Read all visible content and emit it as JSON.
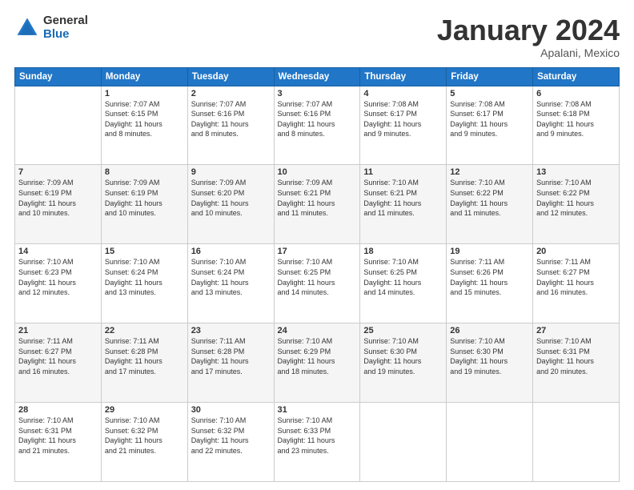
{
  "logo": {
    "general": "General",
    "blue": "Blue"
  },
  "title": "January 2024",
  "location": "Apalani, Mexico",
  "weekdays": [
    "Sunday",
    "Monday",
    "Tuesday",
    "Wednesday",
    "Thursday",
    "Friday",
    "Saturday"
  ],
  "weeks": [
    [
      {
        "day": "",
        "info": ""
      },
      {
        "day": "1",
        "info": "Sunrise: 7:07 AM\nSunset: 6:15 PM\nDaylight: 11 hours\nand 8 minutes."
      },
      {
        "day": "2",
        "info": "Sunrise: 7:07 AM\nSunset: 6:16 PM\nDaylight: 11 hours\nand 8 minutes."
      },
      {
        "day": "3",
        "info": "Sunrise: 7:07 AM\nSunset: 6:16 PM\nDaylight: 11 hours\nand 8 minutes."
      },
      {
        "day": "4",
        "info": "Sunrise: 7:08 AM\nSunset: 6:17 PM\nDaylight: 11 hours\nand 9 minutes."
      },
      {
        "day": "5",
        "info": "Sunrise: 7:08 AM\nSunset: 6:17 PM\nDaylight: 11 hours\nand 9 minutes."
      },
      {
        "day": "6",
        "info": "Sunrise: 7:08 AM\nSunset: 6:18 PM\nDaylight: 11 hours\nand 9 minutes."
      }
    ],
    [
      {
        "day": "7",
        "info": "Sunrise: 7:09 AM\nSunset: 6:19 PM\nDaylight: 11 hours\nand 10 minutes."
      },
      {
        "day": "8",
        "info": "Sunrise: 7:09 AM\nSunset: 6:19 PM\nDaylight: 11 hours\nand 10 minutes."
      },
      {
        "day": "9",
        "info": "Sunrise: 7:09 AM\nSunset: 6:20 PM\nDaylight: 11 hours\nand 10 minutes."
      },
      {
        "day": "10",
        "info": "Sunrise: 7:09 AM\nSunset: 6:21 PM\nDaylight: 11 hours\nand 11 minutes."
      },
      {
        "day": "11",
        "info": "Sunrise: 7:10 AM\nSunset: 6:21 PM\nDaylight: 11 hours\nand 11 minutes."
      },
      {
        "day": "12",
        "info": "Sunrise: 7:10 AM\nSunset: 6:22 PM\nDaylight: 11 hours\nand 11 minutes."
      },
      {
        "day": "13",
        "info": "Sunrise: 7:10 AM\nSunset: 6:22 PM\nDaylight: 11 hours\nand 12 minutes."
      }
    ],
    [
      {
        "day": "14",
        "info": "Sunrise: 7:10 AM\nSunset: 6:23 PM\nDaylight: 11 hours\nand 12 minutes."
      },
      {
        "day": "15",
        "info": "Sunrise: 7:10 AM\nSunset: 6:24 PM\nDaylight: 11 hours\nand 13 minutes."
      },
      {
        "day": "16",
        "info": "Sunrise: 7:10 AM\nSunset: 6:24 PM\nDaylight: 11 hours\nand 13 minutes."
      },
      {
        "day": "17",
        "info": "Sunrise: 7:10 AM\nSunset: 6:25 PM\nDaylight: 11 hours\nand 14 minutes."
      },
      {
        "day": "18",
        "info": "Sunrise: 7:10 AM\nSunset: 6:25 PM\nDaylight: 11 hours\nand 14 minutes."
      },
      {
        "day": "19",
        "info": "Sunrise: 7:11 AM\nSunset: 6:26 PM\nDaylight: 11 hours\nand 15 minutes."
      },
      {
        "day": "20",
        "info": "Sunrise: 7:11 AM\nSunset: 6:27 PM\nDaylight: 11 hours\nand 16 minutes."
      }
    ],
    [
      {
        "day": "21",
        "info": "Sunrise: 7:11 AM\nSunset: 6:27 PM\nDaylight: 11 hours\nand 16 minutes."
      },
      {
        "day": "22",
        "info": "Sunrise: 7:11 AM\nSunset: 6:28 PM\nDaylight: 11 hours\nand 17 minutes."
      },
      {
        "day": "23",
        "info": "Sunrise: 7:11 AM\nSunset: 6:28 PM\nDaylight: 11 hours\nand 17 minutes."
      },
      {
        "day": "24",
        "info": "Sunrise: 7:10 AM\nSunset: 6:29 PM\nDaylight: 11 hours\nand 18 minutes."
      },
      {
        "day": "25",
        "info": "Sunrise: 7:10 AM\nSunset: 6:30 PM\nDaylight: 11 hours\nand 19 minutes."
      },
      {
        "day": "26",
        "info": "Sunrise: 7:10 AM\nSunset: 6:30 PM\nDaylight: 11 hours\nand 19 minutes."
      },
      {
        "day": "27",
        "info": "Sunrise: 7:10 AM\nSunset: 6:31 PM\nDaylight: 11 hours\nand 20 minutes."
      }
    ],
    [
      {
        "day": "28",
        "info": "Sunrise: 7:10 AM\nSunset: 6:31 PM\nDaylight: 11 hours\nand 21 minutes."
      },
      {
        "day": "29",
        "info": "Sunrise: 7:10 AM\nSunset: 6:32 PM\nDaylight: 11 hours\nand 21 minutes."
      },
      {
        "day": "30",
        "info": "Sunrise: 7:10 AM\nSunset: 6:32 PM\nDaylight: 11 hours\nand 22 minutes."
      },
      {
        "day": "31",
        "info": "Sunrise: 7:10 AM\nSunset: 6:33 PM\nDaylight: 11 hours\nand 23 minutes."
      },
      {
        "day": "",
        "info": ""
      },
      {
        "day": "",
        "info": ""
      },
      {
        "day": "",
        "info": ""
      }
    ]
  ]
}
